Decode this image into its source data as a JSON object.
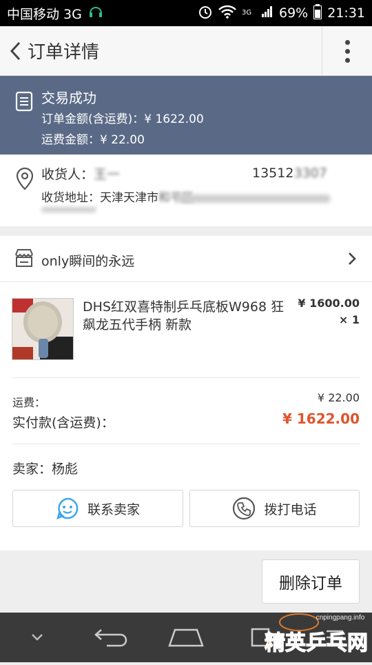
{
  "status_bar": {
    "carrier": "中国移动 3G",
    "network": "3G",
    "battery": "69%",
    "time": "21:31"
  },
  "header": {
    "title": "订单详情"
  },
  "order_status": {
    "title": "交易成功",
    "total_label": "订单金额(含运费)：¥ 1622.00",
    "shipping_label": "运费金额：¥ 22.00"
  },
  "address": {
    "recipient_label": "收货人：",
    "recipient_blur": "王一",
    "phone": "13512",
    "phone_blur": "3307",
    "address_label": "收货地址：天津天津市",
    "address_blur": "和平区"
  },
  "shop": {
    "name": "only瞬间的永远"
  },
  "product": {
    "name": "DHS红双喜特制乒乓底板W968 狂飙龙五代手柄 新款",
    "price": "¥ 1600.00",
    "quantity": "× 1"
  },
  "totals": {
    "shipping_label": "运费：",
    "shipping_value": "¥ 22.00",
    "paid_label": "实付款(含运费)：",
    "paid_value": "¥ 1622.00"
  },
  "seller": {
    "label": "卖家：杨彪"
  },
  "actions": {
    "contact_label": "联系卖家",
    "call_label": "拨打电话",
    "delete_label": "删除订单"
  },
  "watermark": {
    "text": "精英乒乓网",
    "url": "cnpingpang.info"
  },
  "colors": {
    "status_band": "#5a6a86",
    "price_accent": "#e0542b",
    "contact_icon": "#3aa7e8"
  }
}
